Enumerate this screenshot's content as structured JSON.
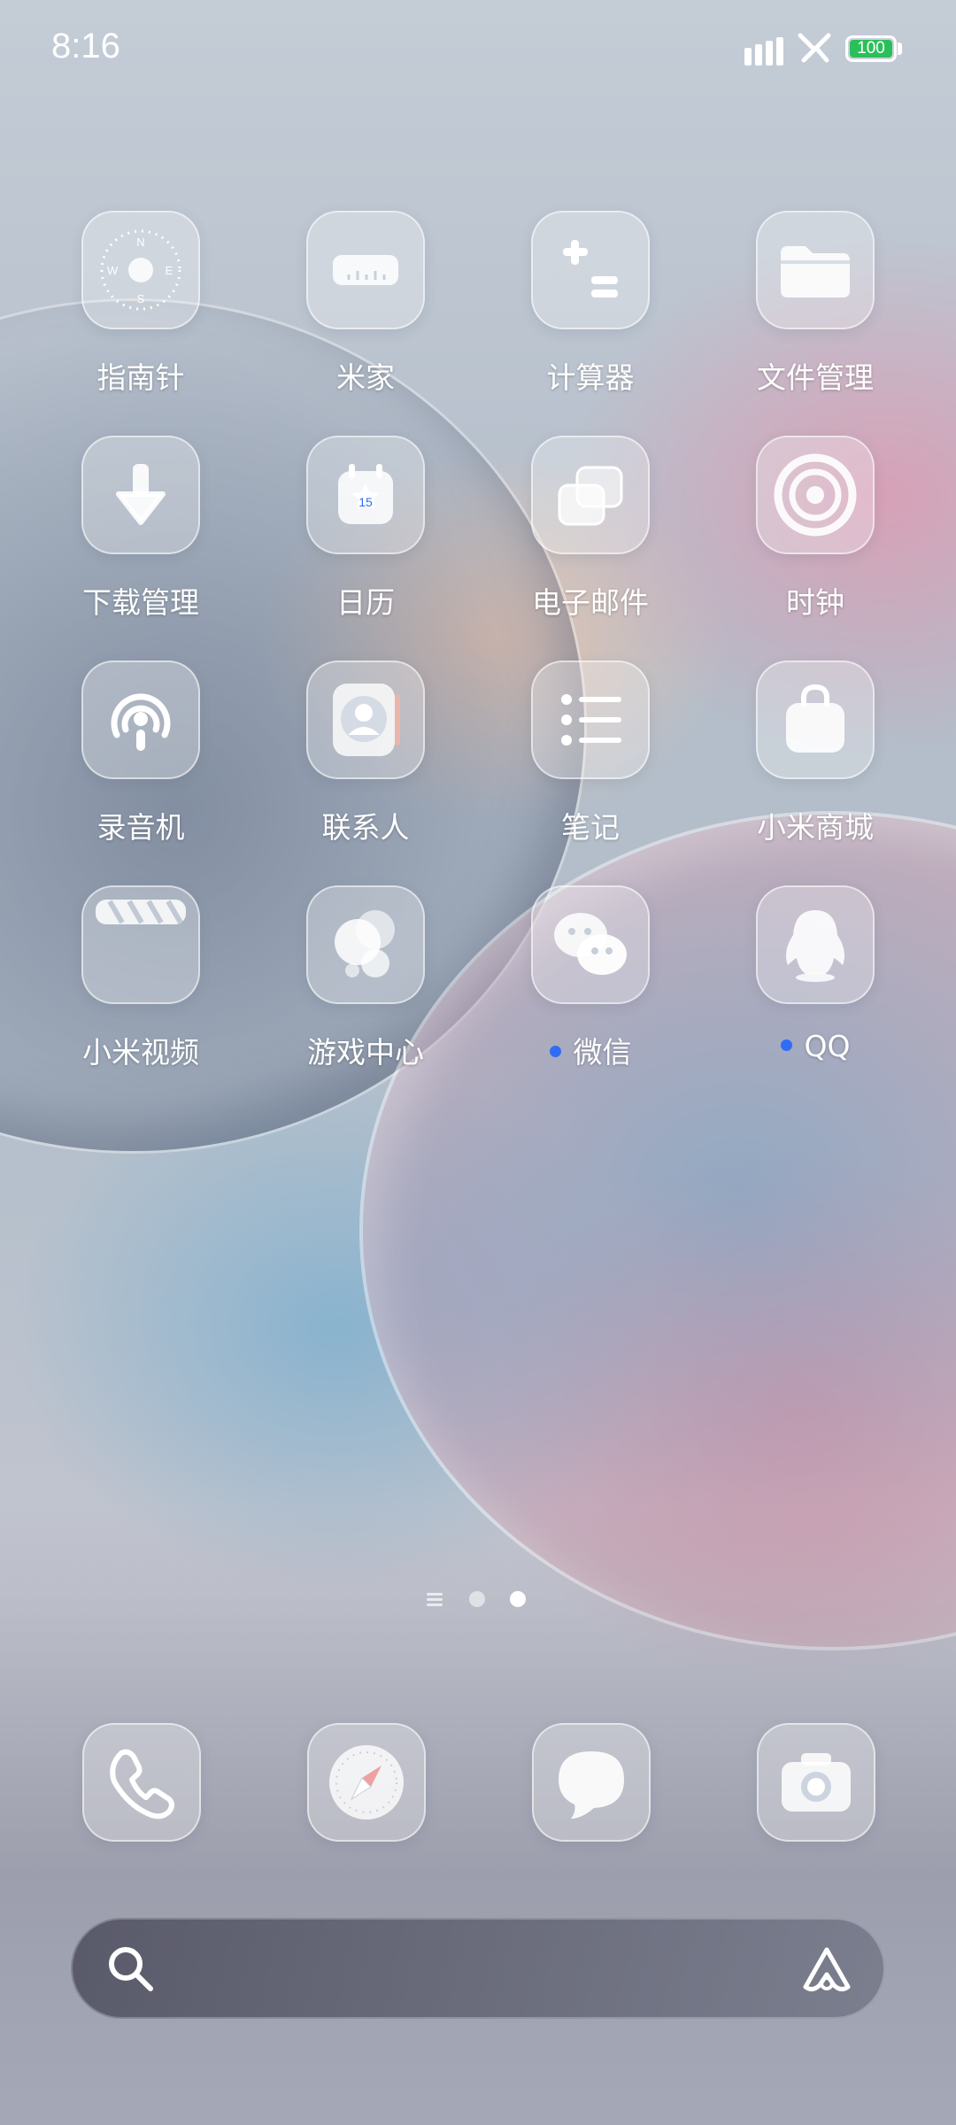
{
  "status_bar": {
    "time": "8:16",
    "battery": "100",
    "icons": [
      "signal-icon",
      "network-icon",
      "battery-icon"
    ]
  },
  "apps": [
    {
      "label": "指南针",
      "icon": "compass-icon"
    },
    {
      "label": "米家",
      "icon": "mijia-icon"
    },
    {
      "label": "计算器",
      "icon": "calculator-icon"
    },
    {
      "label": "文件管理",
      "icon": "folder-icon"
    },
    {
      "label": "下载管理",
      "icon": "download-icon"
    },
    {
      "label": "日历",
      "icon": "calendar-icon",
      "badge_text": "15"
    },
    {
      "label": "电子邮件",
      "icon": "email-icon"
    },
    {
      "label": "时钟",
      "icon": "clock-icon"
    },
    {
      "label": "录音机",
      "icon": "recorder-icon"
    },
    {
      "label": "联系人",
      "icon": "contacts-icon"
    },
    {
      "label": "笔记",
      "icon": "notes-icon"
    },
    {
      "label": "小米商城",
      "icon": "shop-icon"
    },
    {
      "label": "小米视频",
      "icon": "video-icon"
    },
    {
      "label": "游戏中心",
      "icon": "game-center-icon"
    },
    {
      "label": "微信",
      "icon": "wechat-icon",
      "new_dot": true
    },
    {
      "label": "QQ",
      "icon": "qq-icon",
      "new_dot": true
    }
  ],
  "page_indicator": {
    "pages": 2,
    "current": 2
  },
  "dock": [
    {
      "icon": "phone-icon"
    },
    {
      "icon": "browser-icon"
    },
    {
      "icon": "messages-icon"
    },
    {
      "icon": "camera-icon"
    }
  ],
  "search_bar": {
    "icons": [
      "search-icon",
      "assistant-icon"
    ]
  },
  "colors": {
    "notification_dot": "#2f6df5",
    "battery_fill": "#2bbf5a"
  }
}
